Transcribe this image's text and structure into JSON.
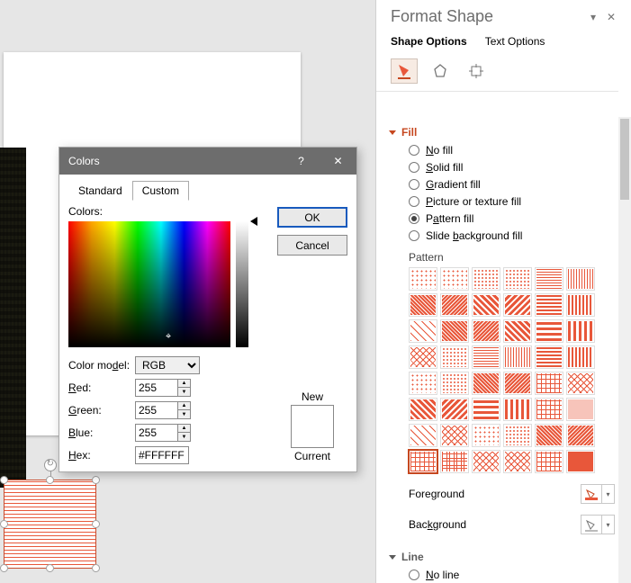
{
  "dialog": {
    "title": "Colors",
    "help_label": "?",
    "close_label": "✕",
    "tab_standard": "Standard",
    "tab_custom": "Custom",
    "colors_label": "Colors:",
    "color_model_label": "Color model:",
    "color_model_value": "RGB",
    "red_label": "Red:",
    "green_label": "Green:",
    "blue_label": "Blue:",
    "hex_label": "Hex:",
    "red_value": "255",
    "green_value": "255",
    "blue_value": "255",
    "hex_value": "#FFFFFF",
    "ok_label": "OK",
    "cancel_label": "Cancel",
    "new_label": "New",
    "current_label": "Current"
  },
  "pane": {
    "title": "Format Shape",
    "tab_shape_options": "Shape Options",
    "tab_text_options": "Text Options",
    "section_fill": "Fill",
    "radio_no_fill": "No fill",
    "radio_solid_fill": "Solid fill",
    "radio_gradient_fill": "Gradient fill",
    "radio_picture_fill": "Picture or texture fill",
    "radio_pattern_fill": "Pattern fill",
    "radio_slide_bg_fill": "Slide background fill",
    "pattern_label": "Pattern",
    "foreground_label": "Foreground",
    "background_label": "Background",
    "section_line": "Line",
    "radio_no_line": "No line"
  }
}
